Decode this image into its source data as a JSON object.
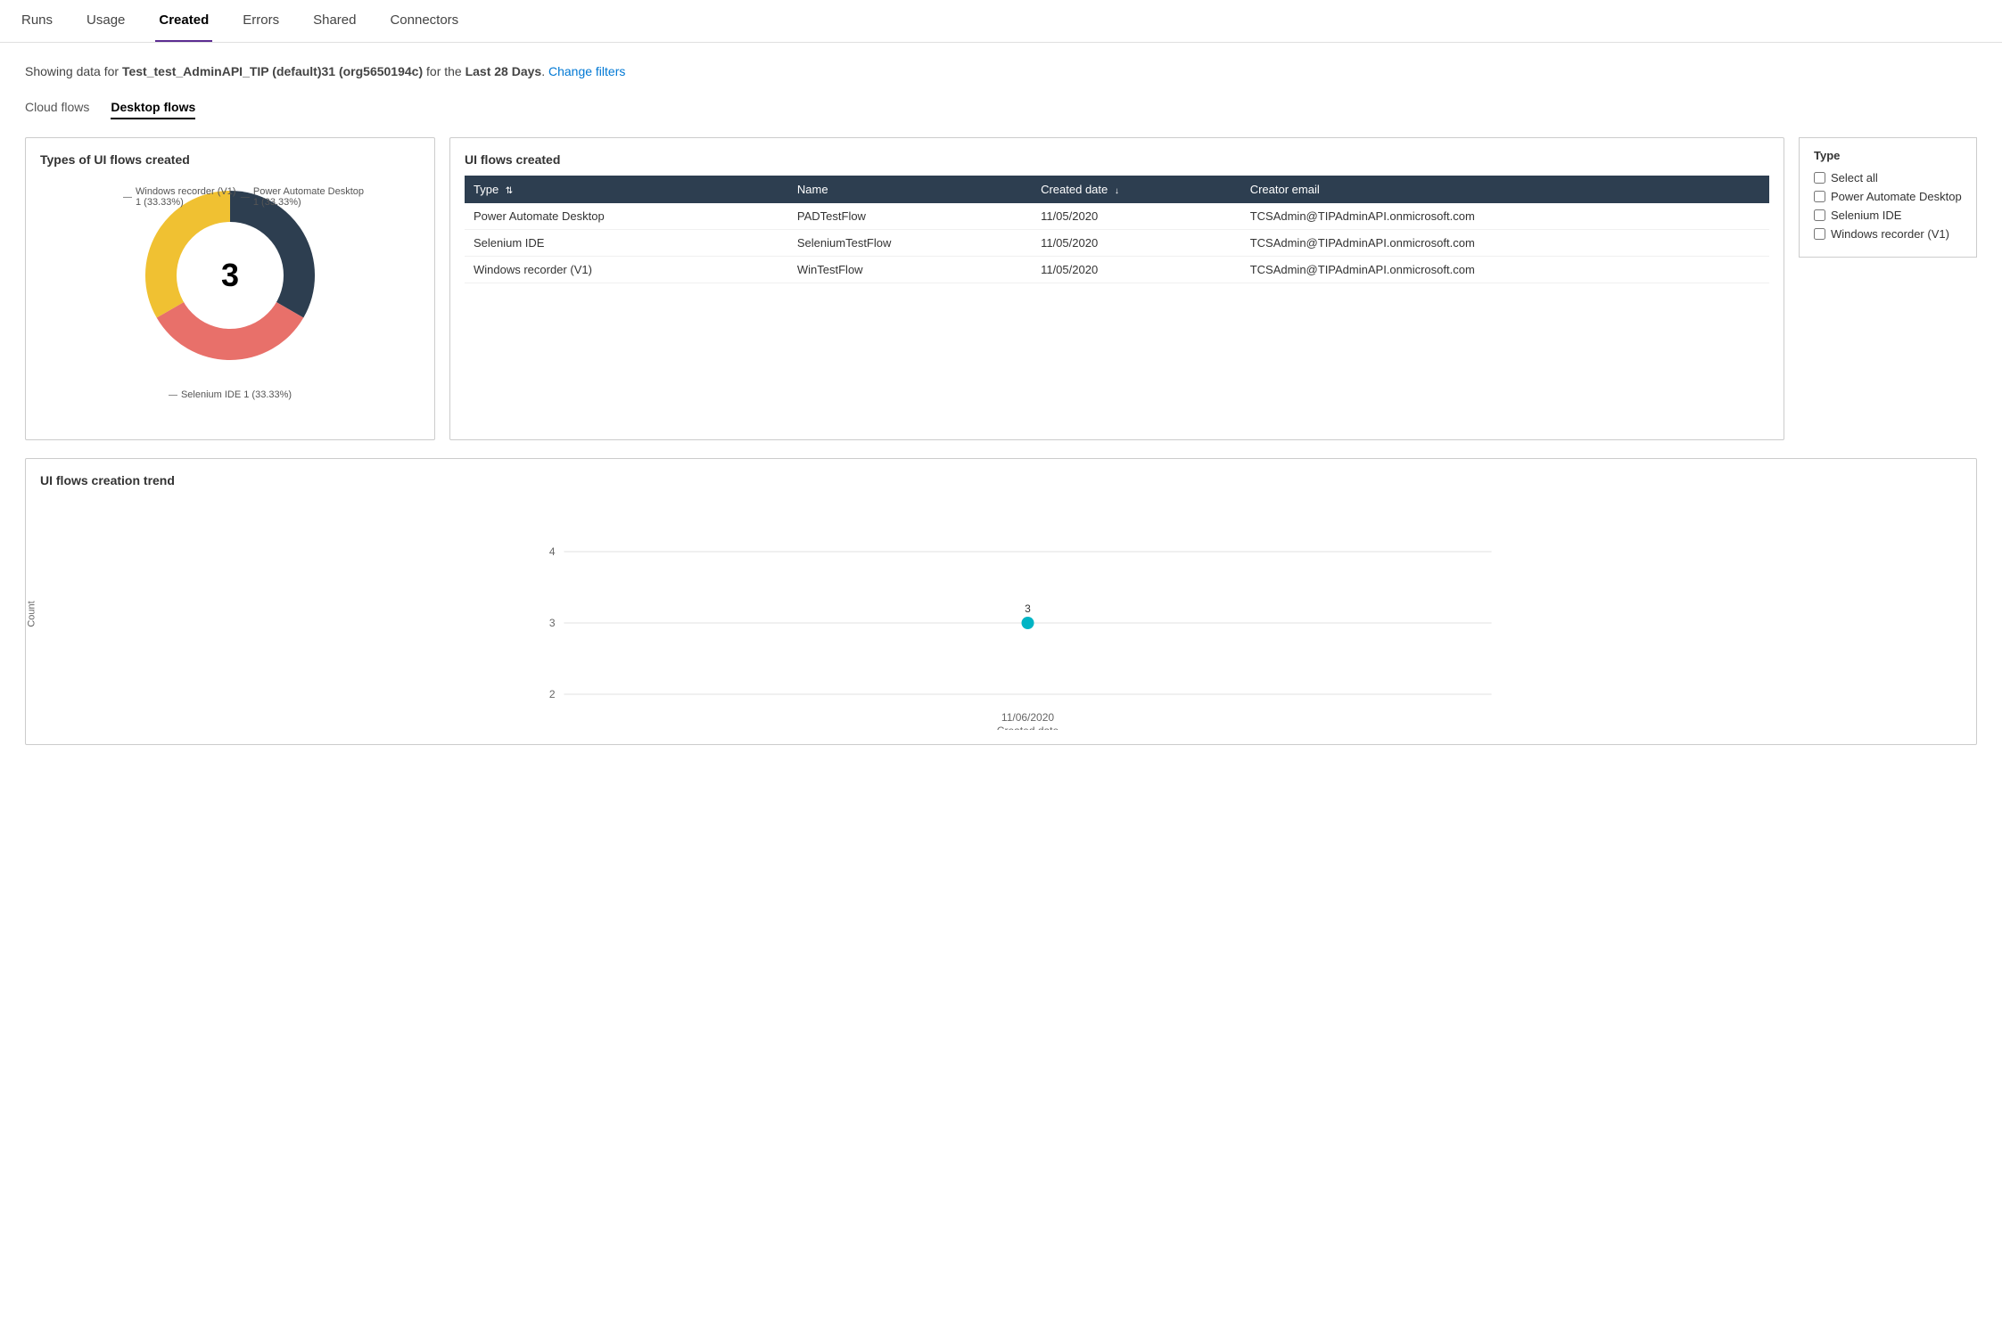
{
  "nav": {
    "items": [
      {
        "label": "Runs",
        "active": false
      },
      {
        "label": "Usage",
        "active": false
      },
      {
        "label": "Created",
        "active": true
      },
      {
        "label": "Errors",
        "active": false
      },
      {
        "label": "Shared",
        "active": false
      },
      {
        "label": "Connectors",
        "active": false
      }
    ]
  },
  "infoBar": {
    "prefix": "Showing data for ",
    "envName": "Test_test_AdminAPI_TIP (default)31 (org5650194c)",
    "forText": " for the ",
    "period": "Last 28 Days",
    "suffix": ".",
    "changeFilters": "Change filters"
  },
  "subTabs": [
    {
      "label": "Cloud flows",
      "active": false
    },
    {
      "label": "Desktop flows",
      "active": true
    }
  ],
  "donutChart": {
    "title": "Types of UI flows created",
    "centerValue": "3",
    "segments": [
      {
        "label": "Power Automate Desktop 1 (33.33%)",
        "color": "#2d3e50",
        "pct": 33.33
      },
      {
        "label": "Selenium IDE 1 (33.33%)",
        "color": "#e8706a",
        "pct": 33.33
      },
      {
        "label": "Windows recorder (V1) 1 (33.33%)",
        "color": "#f0c132",
        "pct": 33.34
      }
    ]
  },
  "table": {
    "title": "UI flows created",
    "columns": [
      {
        "label": "Type",
        "sortable": true
      },
      {
        "label": "Name",
        "sortable": false
      },
      {
        "label": "Created date",
        "sortable": true,
        "sorted": true
      },
      {
        "label": "Creator email",
        "sortable": false
      }
    ],
    "rows": [
      {
        "type": "Power Automate Desktop",
        "name": "PADTestFlow",
        "createdDate": "11/05/2020",
        "email": "TCSAdmin@TIPAdminAPI.onmicrosoft.com"
      },
      {
        "type": "Selenium IDE",
        "name": "SeleniumTestFlow",
        "createdDate": "11/05/2020",
        "email": "TCSAdmin@TIPAdminAPI.onmicrosoft.com"
      },
      {
        "type": "Windows recorder (V1)",
        "name": "WinTestFlow",
        "createdDate": "11/05/2020",
        "email": "TCSAdmin@TIPAdminAPI.onmicrosoft.com"
      }
    ]
  },
  "filterPanel": {
    "title": "Type",
    "items": [
      {
        "label": "Select all",
        "checked": false
      },
      {
        "label": "Power Automate Desktop",
        "checked": false
      },
      {
        "label": "Selenium IDE",
        "checked": false
      },
      {
        "label": "Windows recorder (V1)",
        "checked": false
      }
    ]
  },
  "trendChart": {
    "title": "UI flows creation trend",
    "yAxisLabel": "Count",
    "xAxisLabel": "Created date",
    "yMin": 2,
    "yMax": 4,
    "dataPoint": {
      "x": "11/06/2020",
      "y": 3
    },
    "dotColor": "#00b4c4",
    "yTicks": [
      2,
      3,
      4
    ]
  }
}
